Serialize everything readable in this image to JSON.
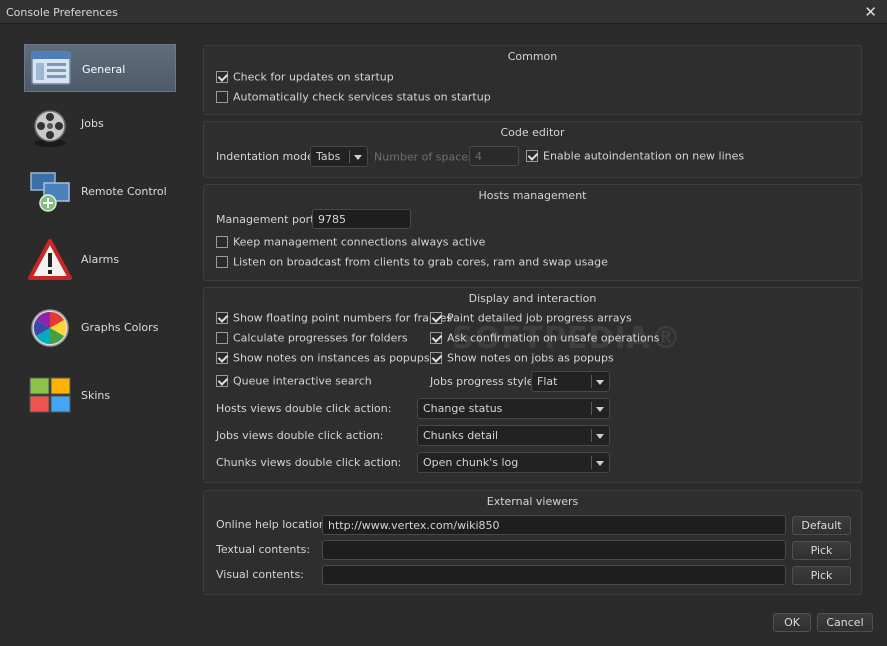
{
  "window": {
    "title": "Console Preferences"
  },
  "sidebar": {
    "items": [
      {
        "label": "General",
        "icon": "window-icon"
      },
      {
        "label": "Jobs",
        "icon": "film-reel-icon"
      },
      {
        "label": "Remote Control",
        "icon": "network-computers-icon"
      },
      {
        "label": "Alarms",
        "icon": "warning-triangle-icon"
      },
      {
        "label": "Graphs Colors",
        "icon": "color-wheel-icon"
      },
      {
        "label": "Skins",
        "icon": "skins-icon"
      }
    ]
  },
  "common": {
    "title": "Common",
    "check_updates": "Check for updates on startup",
    "check_services": "Automatically check services status on startup"
  },
  "code_editor": {
    "title": "Code editor",
    "indentation_label": "Indentation mode:",
    "indentation_value": "Tabs",
    "spaces_label": "Number of spaces:",
    "spaces_value": "4",
    "autoindent": "Enable autoindentation on new lines"
  },
  "hosts": {
    "title": "Hosts management",
    "port_label": "Management port:",
    "port_value": "9785",
    "keep_connections": "Keep management connections always active",
    "listen_broadcast": "Listen on broadcast from clients to grab cores, ram and swap usage"
  },
  "display": {
    "title": "Display and interaction",
    "floating_numbers": "Show floating point numbers for frames",
    "paint_arrays": "Paint detailed job progress arrays",
    "calc_progress": "Calculate progresses for folders",
    "ask_confirm": "Ask confirmation on unsafe operations",
    "notes_instances": "Show notes on instances as popups",
    "notes_jobs": "Show notes on jobs as popups",
    "queue_search": "Queue interactive search",
    "progress_style_label": "Jobs progress style:",
    "progress_style_value": "Flat",
    "hosts_dbl_label": "Hosts views double click action:",
    "hosts_dbl_value": "Change status",
    "jobs_dbl_label": "Jobs views double click action:",
    "jobs_dbl_value": "Chunks detail",
    "chunks_dbl_label": "Chunks views double click action:",
    "chunks_dbl_value": "Open chunk's log"
  },
  "external": {
    "title": "External viewers",
    "help_label": "Online help location:",
    "help_value": "http://www.vertex.com/wiki850",
    "default_button": "Default",
    "textual_label": "Textual contents:",
    "textual_value": "",
    "visual_label": "Visual contents:",
    "visual_value": "",
    "pick_button": "Pick"
  },
  "footer": {
    "ok": "OK",
    "cancel": "Cancel"
  },
  "watermark": "SOFTPEDIA®"
}
